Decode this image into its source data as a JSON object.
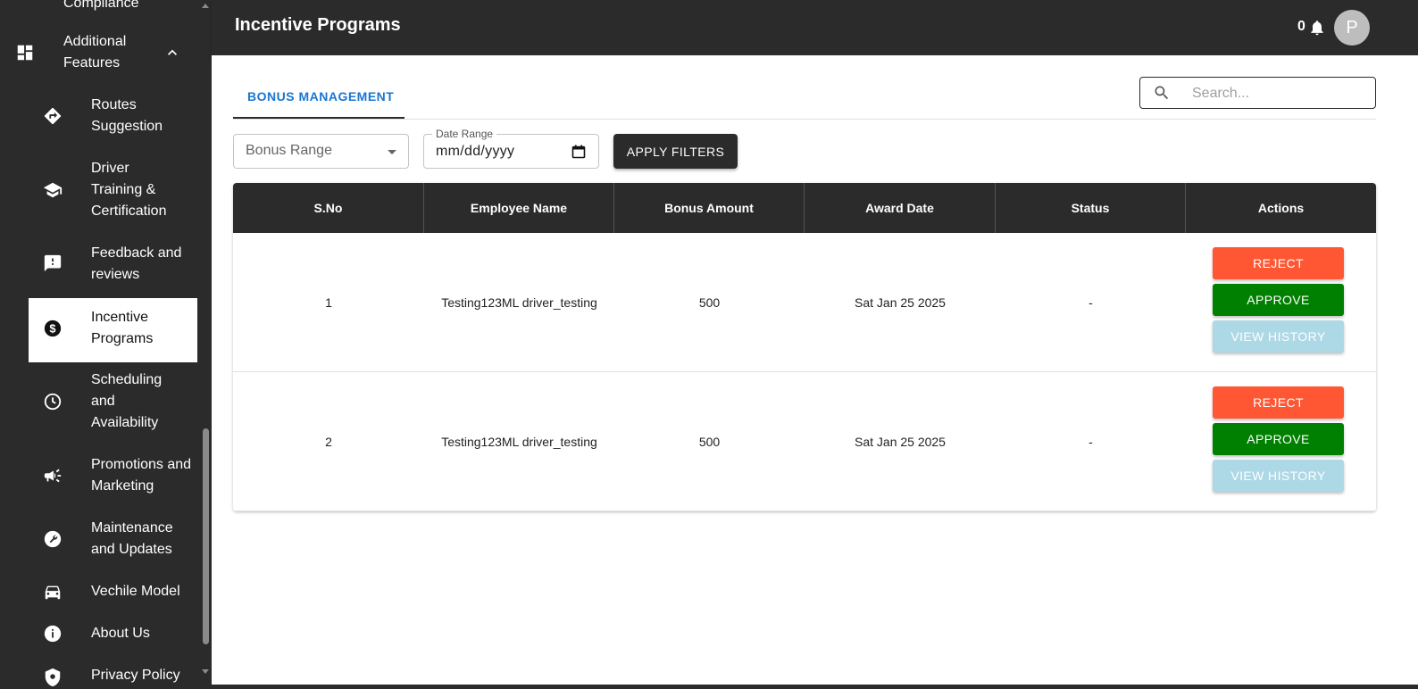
{
  "sidebar": {
    "partial_top": "Compliance",
    "additional_features": "Additional Features",
    "items": [
      {
        "label": "Routes Suggestion",
        "icon": "directions-icon"
      },
      {
        "label": "Driver Training & Certification",
        "icon": "school-icon"
      },
      {
        "label": "Feedback and reviews",
        "icon": "feedback-icon"
      },
      {
        "label": "Incentive Programs",
        "icon": "dollar-icon"
      },
      {
        "label": "Scheduling and Availability",
        "icon": "clock-icon"
      },
      {
        "label": "Promotions and Marketing",
        "icon": "campaign-icon"
      },
      {
        "label": "Maintenance and Updates",
        "icon": "wrench-icon"
      },
      {
        "label": "Vechile Model",
        "icon": "car-icon"
      },
      {
        "label": "About Us",
        "icon": "info-icon"
      },
      {
        "label": "Privacy Policy",
        "icon": "shield-icon"
      }
    ]
  },
  "header": {
    "title": "Incentive Programs",
    "notification_count": "0",
    "avatar_initial": "P"
  },
  "tabs": [
    "BONUS MANAGEMENT"
  ],
  "search": {
    "placeholder": "Search..."
  },
  "filters": {
    "bonus_range": "Bonus Range",
    "date_range_label": "Date Range",
    "date_placeholder": "mm/dd/yyyy",
    "apply": "APPLY FILTERS"
  },
  "table": {
    "columns": [
      "S.No",
      "Employee Name",
      "Bonus Amount",
      "Award Date",
      "Status",
      "Actions"
    ],
    "rows": [
      {
        "sno": "1",
        "name": "Testing123ML driver_testing",
        "amount": "500",
        "date": "Sat Jan 25 2025",
        "status": "-"
      },
      {
        "sno": "2",
        "name": "Testing123ML driver_testing",
        "amount": "500",
        "date": "Sat Jan 25 2025",
        "status": "-"
      }
    ],
    "actions": {
      "reject": "REJECT",
      "approve": "APPROVE",
      "history": "VIEW HISTORY"
    }
  },
  "colors": {
    "dark": "#2b2b2b",
    "accent": "#1976d2",
    "reject": "#ff5733",
    "approve": "#008000",
    "history": "#add8e6"
  }
}
